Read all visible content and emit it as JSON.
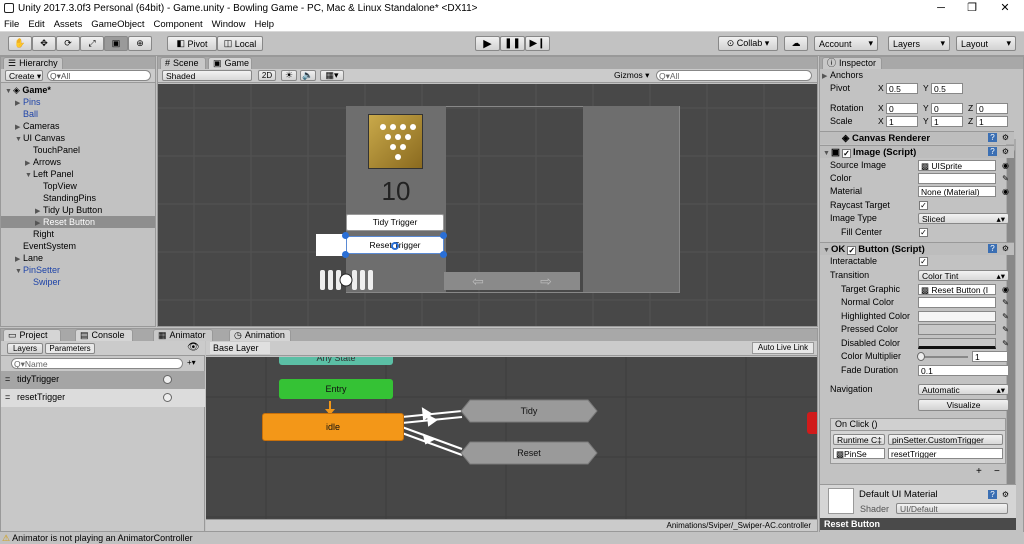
{
  "window": {
    "title": "Unity 2017.3.0f3 Personal (64bit) - Game.unity - Bowling Game - PC, Mac & Linux Standalone* <DX11>",
    "min": "─",
    "max": "❐",
    "close": "✕"
  },
  "menu": [
    "File",
    "Edit",
    "Assets",
    "GameObject",
    "Component",
    "Window",
    "Help"
  ],
  "toolbar": {
    "pivot": "Pivot",
    "local": "Local",
    "collab": "Collab ▾",
    "account": "Account",
    "layers": "Layers",
    "layout": "Layout"
  },
  "hierarchy": {
    "tab": "Hierarchy",
    "create": "Create ▾",
    "search": "Q▾All",
    "items": [
      {
        "label": "Game*",
        "indent": 0,
        "arrow": "▼",
        "bold": true
      },
      {
        "label": "Pins",
        "indent": 1,
        "arrow": "▶",
        "blue": true
      },
      {
        "label": "Ball",
        "indent": 1,
        "arrow": "",
        "blue": true
      },
      {
        "label": "Cameras",
        "indent": 1,
        "arrow": "▶"
      },
      {
        "label": "UI Canvas",
        "indent": 1,
        "arrow": "▼"
      },
      {
        "label": "TouchPanel",
        "indent": 2,
        "arrow": ""
      },
      {
        "label": "Arrows",
        "indent": 2,
        "arrow": "▶"
      },
      {
        "label": "Left Panel",
        "indent": 2,
        "arrow": "▼"
      },
      {
        "label": "TopView",
        "indent": 3,
        "arrow": ""
      },
      {
        "label": "StandingPins",
        "indent": 3,
        "arrow": ""
      },
      {
        "label": "Tidy Up Button",
        "indent": 3,
        "arrow": "▶"
      },
      {
        "label": "Reset Button",
        "indent": 3,
        "arrow": "▶",
        "selected": true
      },
      {
        "label": "Right",
        "indent": 2,
        "arrow": ""
      },
      {
        "label": "EventSystem",
        "indent": 1,
        "arrow": ""
      },
      {
        "label": "Lane",
        "indent": 1,
        "arrow": "▶"
      },
      {
        "label": "PinSetter",
        "indent": 1,
        "arrow": "▼",
        "blue": true
      },
      {
        "label": "Swiper",
        "indent": 2,
        "arrow": "",
        "blue": true
      }
    ]
  },
  "scene": {
    "tabs": [
      "Scene",
      "Game"
    ],
    "shading": "Shaded",
    "mode2d": "2D",
    "gizmos": "Gizmos ▾",
    "search": "Q▾All",
    "score": "10",
    "tidy_button": "Tidy Trigger",
    "reset_button": "Reset Trigger"
  },
  "bottom_tabs": [
    "Project",
    "Console",
    "Animator",
    "Animation"
  ],
  "animator": {
    "subtabs": [
      "Layers",
      "Parameters"
    ],
    "search": "Q▾Name",
    "add": "+▾",
    "params": [
      {
        "name": "tidyTrigger"
      },
      {
        "name": "resetTrigger"
      }
    ],
    "layer": "Base Layer",
    "auto_live": "Auto Live Link",
    "nodes": {
      "any_state": "Any State",
      "entry": "Entry",
      "idle": "idle",
      "tidy": "Tidy",
      "reset": "Reset"
    },
    "path": "Animations/Sviper/_Swiper-AC.controller"
  },
  "inspector": {
    "tab": "Inspector",
    "anchors": "Anchors",
    "pivot": {
      "label": "Pivot",
      "x": "0.5",
      "y": "0.5"
    },
    "rotation": {
      "label": "Rotation",
      "x": "0",
      "y": "0",
      "z": "0"
    },
    "scale": {
      "label": "Scale",
      "x": "1",
      "y": "1",
      "z": "1"
    },
    "canvas_renderer": "Canvas Renderer",
    "image": {
      "title": "Image (Script)",
      "source_label": "Source Image",
      "source_value": "UISprite",
      "color_label": "Color",
      "material_label": "Material",
      "material_value": "None (Material)",
      "raycast_label": "Raycast Target",
      "type_label": "Image Type",
      "type_value": "Sliced",
      "fill_label": "Fill Center"
    },
    "button": {
      "title": "Button (Script)",
      "interactable_label": "Interactable",
      "transition_label": "Transition",
      "transition_value": "Color Tint",
      "target_label": "Target Graphic",
      "target_value": "Reset Button (I",
      "normal": "Normal Color",
      "highlighted": "Highlighted Color",
      "pressed": "Pressed Color",
      "disabled": "Disabled Color",
      "multiplier_label": "Color Multiplier",
      "multiplier_value": "1",
      "fade_label": "Fade Duration",
      "fade_value": "0.1",
      "navigation_label": "Navigation",
      "navigation_value": "Automatic",
      "visualize": "Visualize",
      "onclick": "On Click ()",
      "runtime": "Runtime C‡",
      "function": "pinSetter.CustomTrigger",
      "object": "PinSe",
      "argument": "resetTrigger",
      "plus": "+",
      "minus": "−"
    },
    "material": {
      "name": "Default UI Material",
      "shader_label": "Shader",
      "shader_value": "UI/Default"
    },
    "footer": "Reset Button"
  },
  "status": {
    "text": "Animator is not playing an AnimatorController"
  },
  "colors": {
    "entry": "#35c235",
    "idle": "#f39718",
    "state": "#9a9a9a",
    "any": "#5bbfa5",
    "exit": "#d11b1b",
    "selected": "#8e8e8e"
  }
}
